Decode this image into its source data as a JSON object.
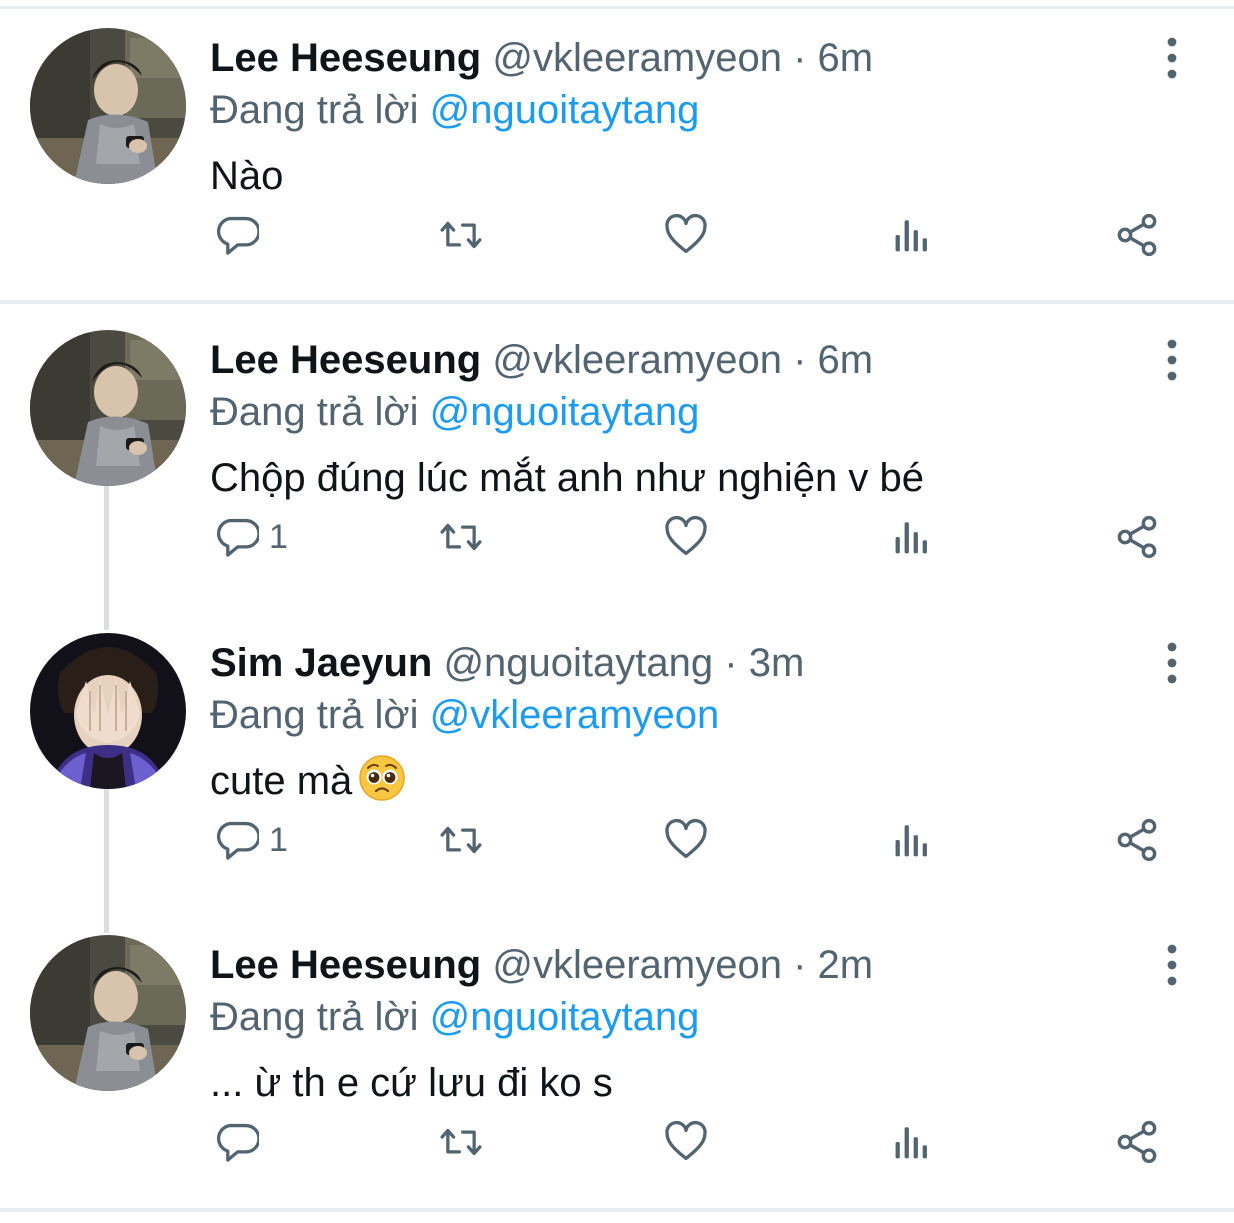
{
  "tweets": [
    {
      "name": "Lee Heeseung",
      "handle": "@vkleeramyeon",
      "time": "· 6m",
      "reply_prefix": "Đang trả lời",
      "reply_to": "@nguoitaytang",
      "text": "Nào",
      "reply_count": "",
      "avatar": "avatar-heeseung"
    },
    {
      "name": "Lee Heeseung",
      "handle": "@vkleeramyeon",
      "time": "· 6m",
      "reply_prefix": "Đang trả lời",
      "reply_to": "@nguoitaytang",
      "text": "Chộp đúng lúc mắt anh như nghiện v bé",
      "reply_count": "1",
      "avatar": "avatar-heeseung"
    },
    {
      "name": "Sim Jaeyun",
      "handle": "@nguoitaytang",
      "time": "· 3m",
      "reply_prefix": "Đang trả lời",
      "reply_to": "@vkleeramyeon",
      "text": "cute mà",
      "emoji": "pleading-face-emoji",
      "reply_count": "1",
      "avatar": "avatar-jaeyun"
    },
    {
      "name": "Lee Heeseung",
      "handle": "@vkleeramyeon",
      "time": "· 2m",
      "reply_prefix": "Đang trả lời",
      "reply_to": "@nguoitaytang",
      "text": "... ừ th e cứ lưu đi ko s",
      "reply_count": "",
      "avatar": "avatar-heeseung"
    }
  ],
  "icons": {
    "reply": "reply-icon",
    "retweet": "retweet-icon",
    "like": "like-icon",
    "views": "views-icon",
    "share": "share-icon",
    "more": "more-icon"
  },
  "colors": {
    "name": "#0f1419",
    "meta": "#536471",
    "link": "#1d9bf0",
    "divider": "#e6ecf0",
    "thread_line": "#d9dee2"
  }
}
